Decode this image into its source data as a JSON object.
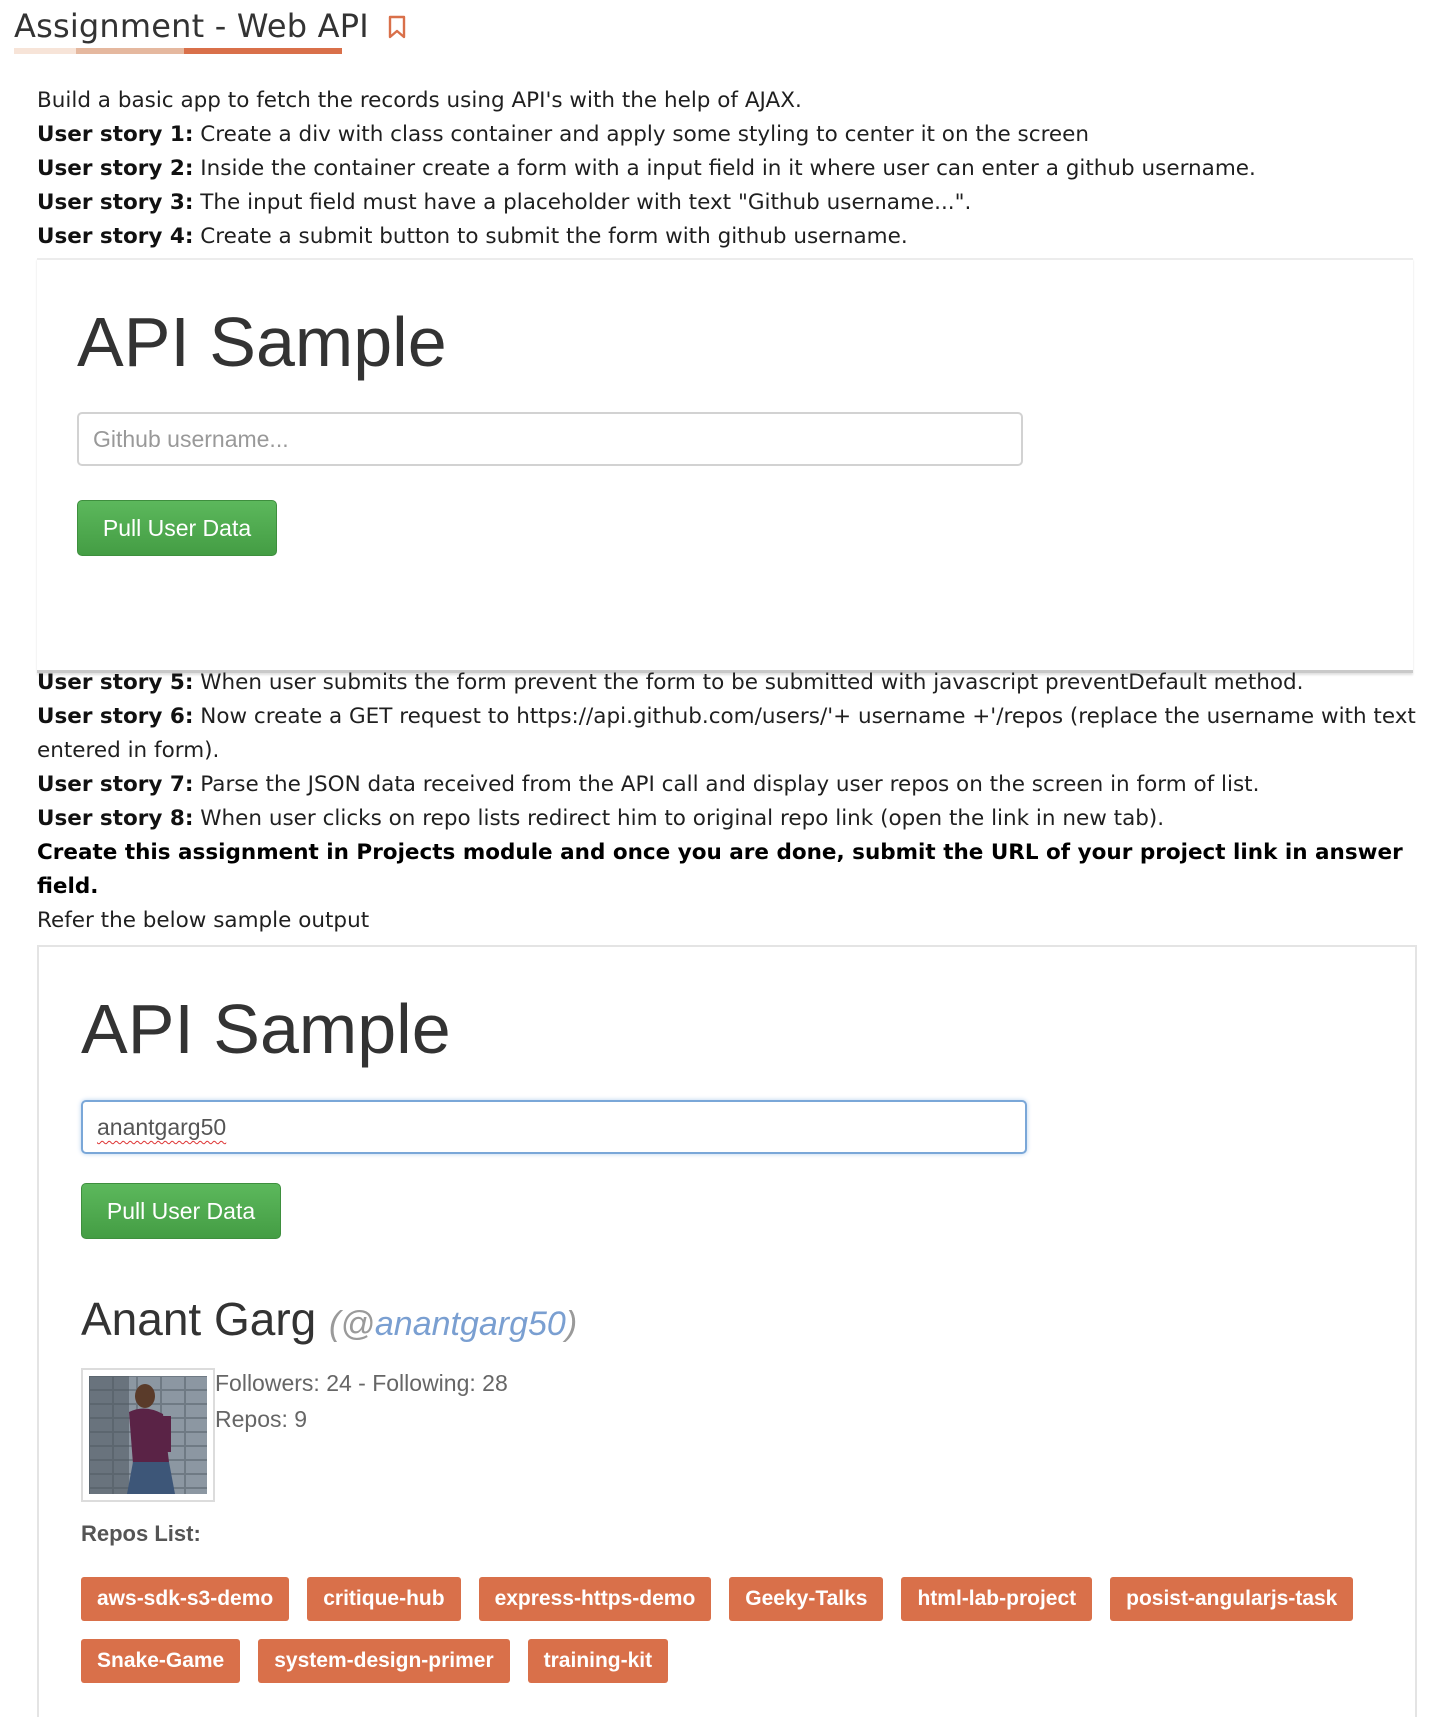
{
  "page": {
    "title": "Assignment - Web API"
  },
  "intro": {
    "line1": "Build a basic app to fetch the records using API's with the help of AJAX.",
    "stories_top": [
      {
        "label": "User story 1:",
        "text": " Create a div with class container and apply some styling to center it on the screen"
      },
      {
        "label": "User story 2:",
        "text": " Inside the container create a form with a input field in it where user can enter a github username."
      },
      {
        "label": "User story 3:",
        "text": " The input field must have a placeholder with text \"Github username...\"."
      },
      {
        "label": "User story 4:",
        "text": " Create a submit button to submit the form with github username."
      }
    ]
  },
  "sample1": {
    "title": "API Sample",
    "placeholder": "Github username...",
    "button": "Pull User Data"
  },
  "stories_bottom": [
    {
      "label": "User story 5:",
      "text": " When user submits the form prevent the form to be submitted with javascript preventDefault method."
    },
    {
      "label": "User story 6:",
      "text": " Now create a GET request to https://api.github.com/users/'+ username +'/repos (replace the username with text entered in form)."
    },
    {
      "label": "User story 7:",
      "text": " Parse the JSON data received from the API call and display user repos on the screen in form of list."
    },
    {
      "label": "User story 8:",
      "text": " When user clicks on repo lists redirect him to original repo link (open the link in new tab)."
    }
  ],
  "instruction": "Create this assignment in Projects module and once you are done, submit the URL of your project link in answer field.",
  "refer": "Refer the below sample output",
  "sample2": {
    "title": "API Sample",
    "input_value": "anantgarg50",
    "button": "Pull User Data",
    "user_name": "Anant Garg",
    "handle_open": "(@",
    "handle": "anantgarg50",
    "handle_close": ")",
    "followers_line": "Followers: 24 - Following: 28",
    "repos_line": "Repos: 9",
    "repos_label": "Repos List:",
    "repos": [
      "aws-sdk-s3-demo",
      "critique-hub",
      "express-https-demo",
      "Geeky-Talks",
      "html-lab-project",
      "posist-angularjs-task",
      "Snake-Game",
      "system-design-primer",
      "training-kit"
    ]
  },
  "colors": {
    "accent": "#d9704a",
    "button_green": "#5cb85c",
    "handle_blue": "#7a9fd1"
  }
}
